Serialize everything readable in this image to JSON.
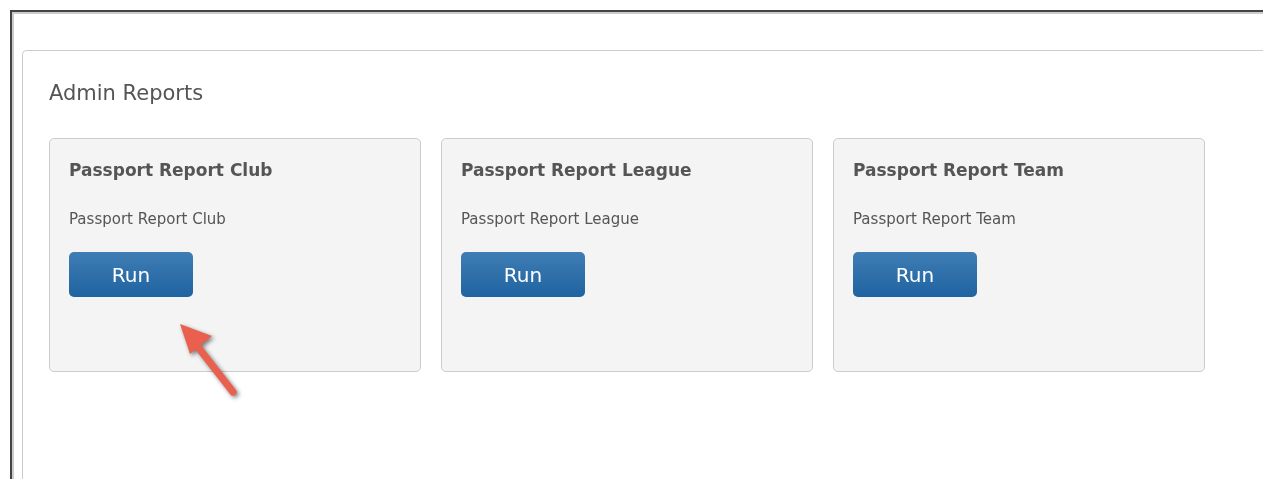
{
  "panel": {
    "title": "Admin Reports"
  },
  "reports": [
    {
      "title": "Passport Report Club",
      "description": "Passport Report Club",
      "button": "Run"
    },
    {
      "title": "Passport Report League",
      "description": "Passport Report League",
      "button": "Run"
    },
    {
      "title": "Passport Report Team",
      "description": "Passport Report Team",
      "button": "Run"
    }
  ]
}
